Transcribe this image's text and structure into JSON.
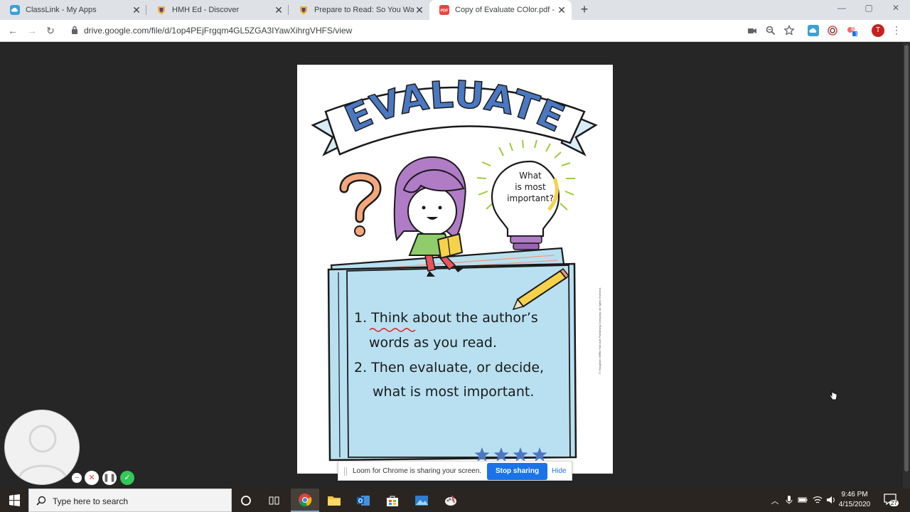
{
  "browser": {
    "tabs": [
      {
        "title": "ClassLink - My Apps",
        "favicon": "classlink-cloud-icon",
        "active": false
      },
      {
        "title": "HMH Ed - Discover",
        "favicon": "hmh-shield-icon",
        "active": false
      },
      {
        "title": "Prepare to Read: So You Want to",
        "favicon": "hmh-shield-icon",
        "active": false
      },
      {
        "title": "Copy of Evaluate COlor.pdf - Goo",
        "favicon": "pdf-icon",
        "active": true
      }
    ],
    "new_tab_label": "+",
    "url": "drive.google.com/file/d/1op4PEjFrgqm4GL5ZGA3IYawXihrgVHFS/view",
    "profile_initial": "T",
    "extension_badge": "1"
  },
  "poster": {
    "banner_title": "EVALUATE",
    "bulb_text": [
      "What",
      "is most",
      "important?"
    ],
    "question_mark": "?",
    "steps": [
      {
        "line1": "1. Think about the author’s",
        "line2": "words as you read."
      },
      {
        "line1": "2. Then evaluate, or decide,",
        "line2": "what is most important."
      }
    ],
    "star_count": 4,
    "copyright": "© Houghton Mifflin Harcourt Publishing Company. All rights reserved."
  },
  "loom": {
    "share_message": "Loom for Chrome is sharing your screen.",
    "stop_label": "Stop sharing",
    "hide_label": "Hide"
  },
  "taskbar": {
    "search_placeholder": "Type here to search",
    "time": "9:46 PM",
    "date": "4/15/2020",
    "notification_count": "27"
  },
  "colors": {
    "banner_blue": "#4a78c2",
    "book_blue": "#b8e0f0",
    "hair_purple": "#b07cc6",
    "question_orange": "#f4a77c",
    "bulb_green": "#9ccc3c",
    "loom_blue": "#1a73e8"
  }
}
